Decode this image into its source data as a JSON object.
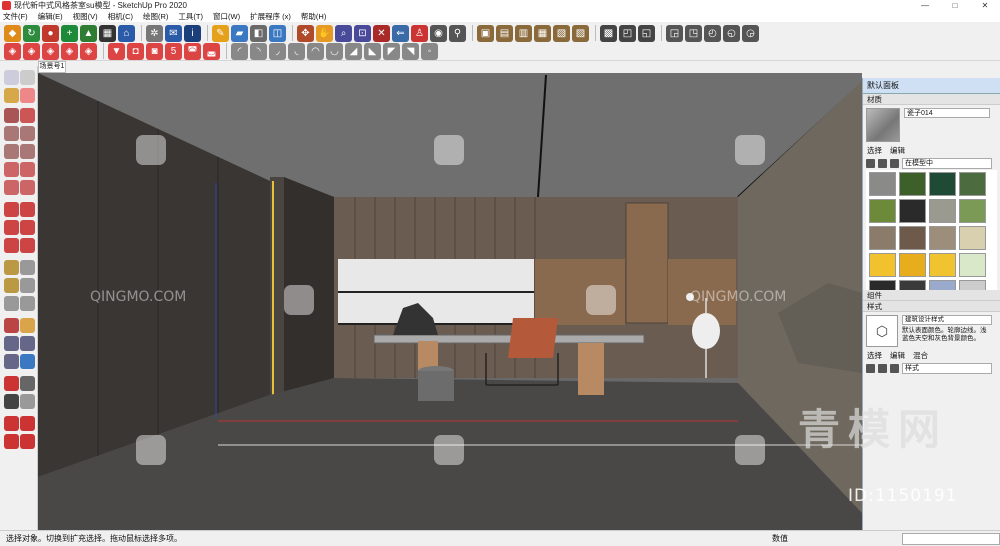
{
  "window": {
    "title": "现代新中式风格茶室su模型 - SketchUp Pro 2020",
    "controls": [
      "—",
      "□",
      "✕"
    ]
  },
  "menu": [
    "文件(F)",
    "编辑(E)",
    "视图(V)",
    "相机(C)",
    "绘图(R)",
    "工具(T)",
    "窗口(W)",
    "扩展程序 (x)",
    "帮助(H)"
  ],
  "scene_tab": "场景号1",
  "panel": {
    "title": "默认面板",
    "materials_header": "材质",
    "material_name": "瓷子014",
    "tabs": [
      "选择",
      "编辑"
    ],
    "collection": "在模型中",
    "swatch_colors": [
      "#8a8a88",
      "#3d5f2a",
      "#1f4a35",
      "#4c6b3f",
      "#6d8a3a",
      "#2a2a2a",
      "#9a9a90",
      "#7a9a55",
      "#8b7b6a",
      "#6e5a4a",
      "#9c8e7a",
      "#d9d0b0",
      "#f2c12e",
      "#e8ad1c",
      "#f0c330",
      "#d8e8c8",
      "#2a2a2a",
      "#3a3a3a",
      "#99aacc",
      "#cccccc"
    ],
    "components_header": "组件",
    "styles_header": "样式",
    "style_name": "建筑设计样式",
    "style_desc": "默认表面颜色。轮廓边线。浅蓝色天空和灰色背景颜色。",
    "style_tabs": [
      "选择",
      "编辑",
      "混合"
    ],
    "style_sel": "样式"
  },
  "status": {
    "message": "选择对象。切换到扩充选择。拖动鼠标选择多项。",
    "measurement_label": "数值"
  },
  "watermark": {
    "brand_cn": "青模网",
    "id_text": "ID:1150191",
    "site": "QINGMO.COM"
  }
}
